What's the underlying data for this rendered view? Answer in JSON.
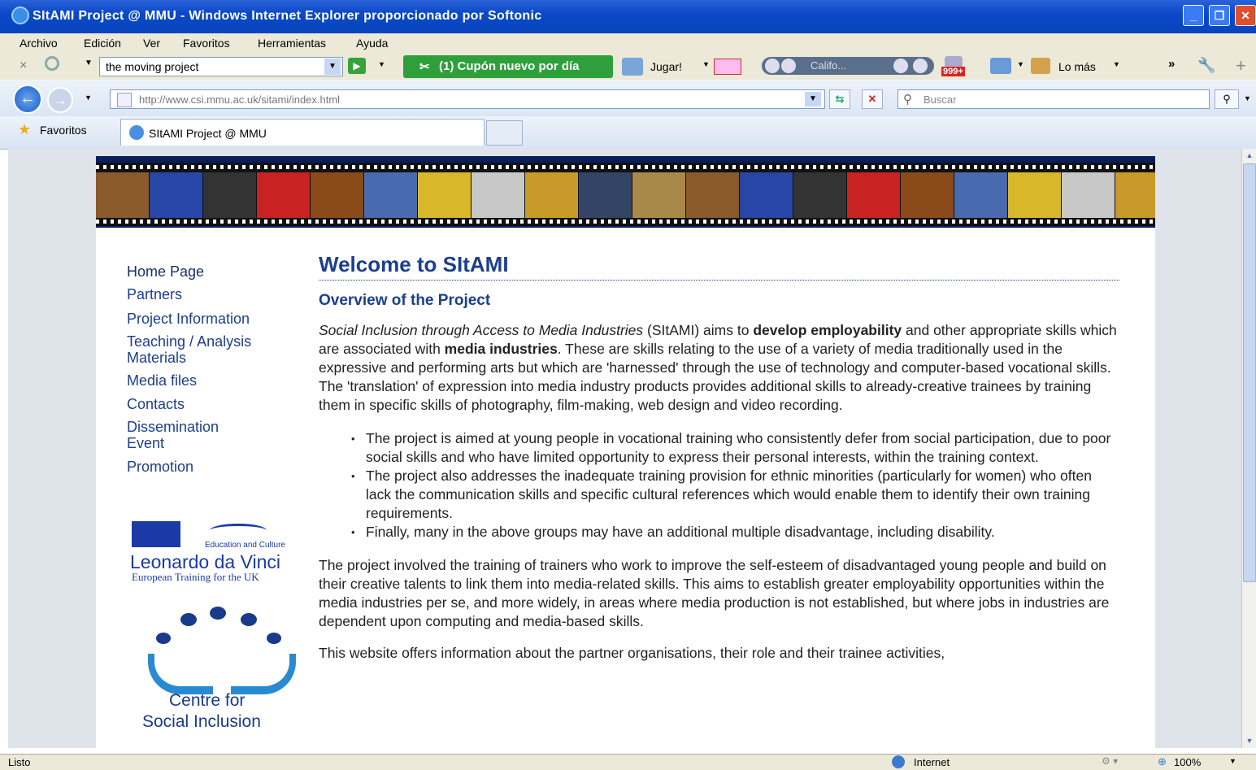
{
  "window": {
    "title": "SItAMI Project @ MMU - Windows Internet Explorer proporcionado por Softonic"
  },
  "menu": [
    "Archivo",
    "Edición",
    "Ver",
    "Favoritos",
    "Herramientas",
    "Ayuda"
  ],
  "toolbar": {
    "search_value": "the moving project",
    "coupon": "(1) Cupón nuevo por día",
    "jugar": "Jugar!",
    "radio": "Califo...",
    "badge": "999+",
    "lomas": "Lo más"
  },
  "address": {
    "url": "http://www.csi.mmu.ac.uk/sitami/index.html",
    "search_placeholder": "Buscar"
  },
  "favorites": {
    "label": "Favoritos",
    "tab": "SItAMI Project @ MMU"
  },
  "nav": [
    "Home Page",
    "Partners",
    "Project Information",
    "Teaching / Analysis",
    "Materials",
    "Media files",
    "Contacts",
    "Dissemination",
    "Event",
    "Promotion"
  ],
  "logos": {
    "edu": "Education and Culture",
    "ldv": "Leonardo da Vinci",
    "ldv_sub": "European Training for the UK",
    "csi1": "Centre for",
    "csi2": "Social Inclusion"
  },
  "content": {
    "title": "Welcome to SItAMI",
    "subtitle": "Overview of the Project",
    "p1_italic": "Social Inclusion through Access to Media Industries",
    "p1_a": " (SItAMI) aims to ",
    "p1_b1": "develop employability",
    "p1_c": " and other appropriate skills which are associated with ",
    "p1_b2": "media industries",
    "p1_d": ". These are skills relating to the use of a variety of media traditionally used in the expressive and performing arts but which are 'harnessed' through the use of technology and computer-based vocational skills. The 'translation' of expression into media industry products provides additional skills to already-creative trainees by training them in specific skills of photography, film-making, web design and video recording.",
    "bullets": [
      "The project is aimed at young people in vocational training who consistently defer from social participation, due to poor social skills and who have limited opportunity to express their personal interests, within the training context.",
      "The project also addresses the inadequate training provision for ethnic minorities (particularly for women) who often lack the communication skills and specific cultural references which would enable them to identify their own training requirements.",
      "Finally, many in the above groups may have an additional multiple disadvantage, including disability."
    ],
    "p2": "The project involved the training of trainers who work to improve the self-esteem of disadvantaged young people and build on their creative talents to link them into media-related skills. This aims to establish greater employability opportunities within the media industries per se, and more widely, in areas where media production is not established, but where jobs in industries are dependent upon computing and media-based skills.",
    "p3": "This website offers information about the partner organisations, their role and their trainee activities,"
  },
  "status": {
    "left": "Listo",
    "zone": "Internet",
    "zoom": "100%"
  }
}
